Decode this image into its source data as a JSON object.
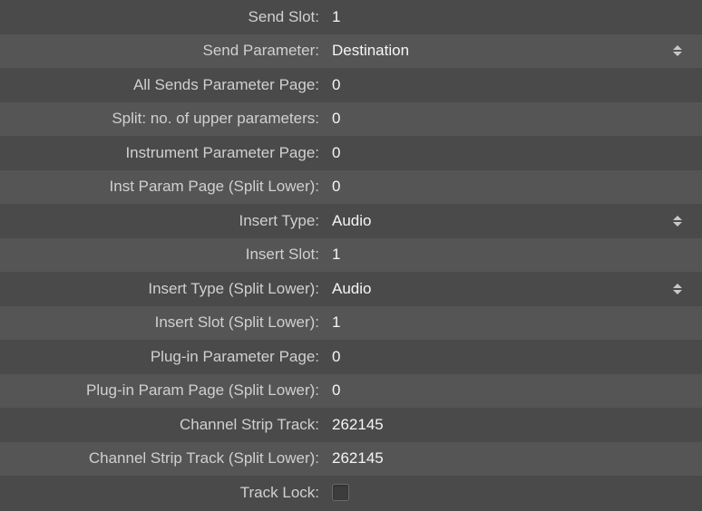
{
  "rows": [
    {
      "label": "Send Slot:",
      "value": "1",
      "dropdown": false,
      "checkbox": false
    },
    {
      "label": "Send Parameter:",
      "value": "Destination",
      "dropdown": true,
      "checkbox": false
    },
    {
      "label": "All Sends Parameter Page:",
      "value": "0",
      "dropdown": false,
      "checkbox": false
    },
    {
      "label": "Split: no. of upper parameters:",
      "value": "0",
      "dropdown": false,
      "checkbox": false
    },
    {
      "label": "Instrument Parameter Page:",
      "value": "0",
      "dropdown": false,
      "checkbox": false
    },
    {
      "label": "Inst Param Page (Split Lower):",
      "value": "0",
      "dropdown": false,
      "checkbox": false
    },
    {
      "label": "Insert Type:",
      "value": "Audio",
      "dropdown": true,
      "checkbox": false
    },
    {
      "label": "Insert Slot:",
      "value": "1",
      "dropdown": false,
      "checkbox": false
    },
    {
      "label": "Insert Type (Split Lower):",
      "value": "Audio",
      "dropdown": true,
      "checkbox": false
    },
    {
      "label": "Insert Slot (Split Lower):",
      "value": "1",
      "dropdown": false,
      "checkbox": false
    },
    {
      "label": "Plug-in Parameter Page:",
      "value": "0",
      "dropdown": false,
      "checkbox": false
    },
    {
      "label": "Plug-in Param Page (Split Lower):",
      "value": "0",
      "dropdown": false,
      "checkbox": false
    },
    {
      "label": "Channel Strip Track:",
      "value": "262145",
      "dropdown": false,
      "checkbox": false
    },
    {
      "label": "Channel Strip Track (Split Lower):",
      "value": "262145",
      "dropdown": false,
      "checkbox": false
    },
    {
      "label": "Track Lock:",
      "value": "",
      "dropdown": false,
      "checkbox": true
    }
  ]
}
